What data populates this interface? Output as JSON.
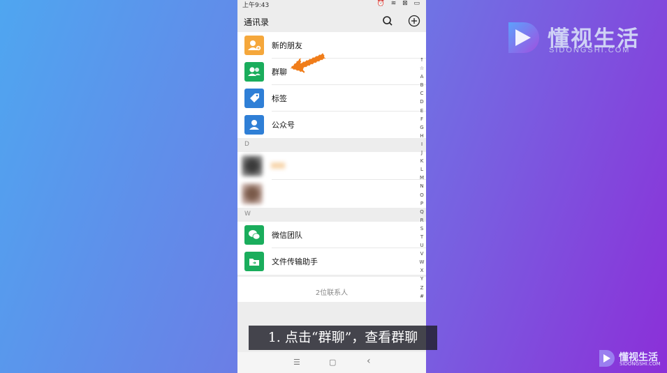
{
  "status_bar": {
    "time": "上午9:43",
    "icons": "⏰ ≋ ⊠ ▭"
  },
  "header": {
    "title": "通讯录"
  },
  "menu_items": [
    {
      "label": "新的朋友",
      "color": "#f5a73b",
      "icon": "add-friend-icon"
    },
    {
      "label": "群聊",
      "color": "#1aad5c",
      "icon": "group-chat-icon"
    },
    {
      "label": "标签",
      "color": "#2f7fd6",
      "icon": "tag-icon"
    },
    {
      "label": "公众号",
      "color": "#2f7fd6",
      "icon": "official-account-icon"
    }
  ],
  "sections": {
    "d": "D",
    "w": "W"
  },
  "w_contacts": [
    {
      "label": "微信团队",
      "color": "#1aad5c",
      "icon": "wechat-icon"
    },
    {
      "label": "文件传输助手",
      "color": "#1aad5c",
      "icon": "folder-icon"
    }
  ],
  "index_letters": [
    "↑",
    "☆",
    "A",
    "B",
    "C",
    "D",
    "E",
    "F",
    "G",
    "H",
    "I",
    "J",
    "K",
    "L",
    "M",
    "N",
    "O",
    "P",
    "Q",
    "R",
    "S",
    "T",
    "U",
    "V",
    "W",
    "X",
    "Y",
    "Z",
    "#"
  ],
  "contact_count": "2位联系人",
  "nav": {
    "menu": "☰",
    "home": "▢",
    "back": "‹"
  },
  "caption": "1. 点击“群聊”，查看群聊",
  "watermark": {
    "name": "懂视生活",
    "domain": "SIDONGSHI.COM"
  },
  "colors": {
    "arrow": "#f07d1a",
    "accent_green": "#1aad5c"
  }
}
